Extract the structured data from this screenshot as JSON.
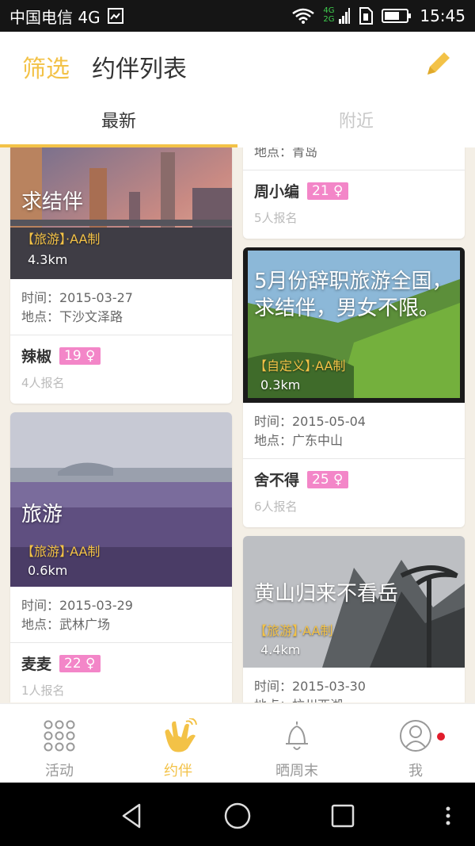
{
  "status_bar": {
    "carrier": "中国电信 4G",
    "network_tag_top": "4G",
    "network_tag_bottom": "2G",
    "time": "15:45"
  },
  "header": {
    "filter_label": "筛选",
    "title": "约伴列表"
  },
  "tabs": [
    {
      "label": "最新",
      "active": true
    },
    {
      "label": "附近",
      "active": false
    }
  ],
  "cards": [
    {
      "title": "求结伴",
      "type": "【旅游】·AA制",
      "distance": "4.3km",
      "time": "时间：2015-03-27",
      "place": "地点：下沙文泽路",
      "name": "辣椒",
      "age": "19 ♀",
      "signups": "4人报名"
    },
    {
      "title": "旅游",
      "type": "【旅游】·AA制",
      "distance": "0.6km",
      "time": "时间：2015-03-29",
      "place": "地点：武林广场",
      "name": "麦麦",
      "age": "22 ♀",
      "signups": "1人报名"
    },
    {
      "place": "地点：青岛",
      "name": "周小编",
      "age": "21 ♀",
      "signups": "5人报名"
    },
    {
      "title": "5月份辞职旅游全国，求结伴，男女不限。",
      "type": "【自定义】·AA制",
      "distance": "0.3km",
      "time": "时间：2015-05-04",
      "place": "地点：广东中山",
      "name": "舍不得",
      "age": "25 ♀",
      "signups": "6人报名"
    },
    {
      "title": "黄山归来不看岳",
      "type": "【旅游】·AA制",
      "distance": "4.4km",
      "time": "时间：2015-03-30",
      "place": "地点：杭州西湖"
    }
  ],
  "bottom_nav": [
    {
      "label": "活动",
      "icon": "grid-dots-icon",
      "active": false
    },
    {
      "label": "约伴",
      "icon": "hand-gesture-icon",
      "active": true
    },
    {
      "label": "晒周末",
      "icon": "bell-icon",
      "active": false
    },
    {
      "label": "我",
      "icon": "user-icon",
      "active": false,
      "badge": true
    }
  ],
  "colors": {
    "accent": "#f3c247",
    "age_badge": "#f386c8",
    "notification_dot": "#e11c2b"
  }
}
